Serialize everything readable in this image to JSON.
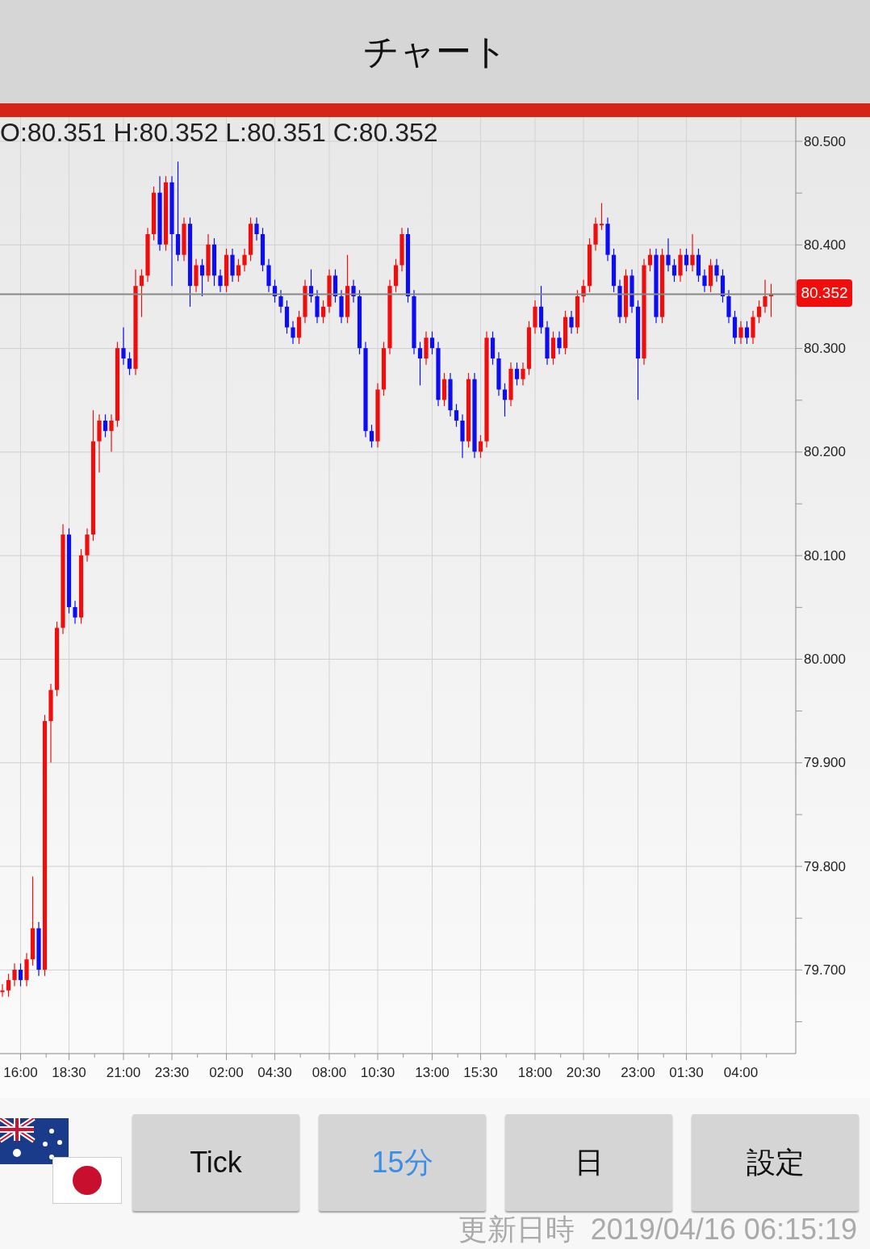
{
  "header": {
    "title": "チャート"
  },
  "chart": {
    "ohlc_readout": "O:80.351 H:80.352 L:80.351 C:80.352",
    "current_price": "80.352",
    "chart_data": {
      "type": "candlestick",
      "categories": [
        null,
        null,
        null,
        "16:00",
        null,
        null,
        null,
        null,
        null,
        null,
        null,
        "18:30",
        null,
        null,
        null,
        null,
        null,
        null,
        null,
        null,
        "21:00",
        null,
        null,
        null,
        null,
        null,
        null,
        null,
        "23:30",
        null,
        null,
        null,
        null,
        null,
        null,
        null,
        null,
        "02:00",
        null,
        null,
        null,
        null,
        null,
        null,
        null,
        "04:30",
        null,
        null,
        null,
        null,
        null,
        null,
        null,
        null,
        "08:00",
        null,
        null,
        null,
        null,
        null,
        null,
        null,
        "10:30",
        null,
        null,
        null,
        null,
        null,
        null,
        null,
        null,
        "13:00",
        null,
        null,
        null,
        null,
        null,
        null,
        null,
        "15:30",
        null,
        null,
        null,
        null,
        null,
        null,
        null,
        null,
        "18:00",
        null,
        null,
        null,
        null,
        null,
        null,
        null,
        "20:30",
        null,
        null,
        null,
        null,
        null,
        null,
        null,
        null,
        "23:00",
        null,
        null,
        null,
        null,
        null,
        null,
        null,
        "01:30",
        null,
        null,
        null,
        null,
        null,
        null,
        null,
        null,
        "04:00",
        null,
        null,
        null,
        null,
        null
      ],
      "ylim": [
        79.619,
        80.523
      ],
      "ohlc": [
        [
          79.68,
          79.686,
          79.674,
          79.68
        ],
        [
          79.68,
          79.696,
          79.674,
          79.69
        ],
        [
          79.69,
          79.706,
          79.684,
          79.7
        ],
        [
          79.7,
          79.706,
          79.684,
          79.69
        ],
        [
          79.69,
          79.716,
          79.684,
          79.71
        ],
        [
          79.71,
          79.79,
          79.704,
          79.74
        ],
        [
          79.74,
          79.746,
          79.694,
          79.7
        ],
        [
          79.7,
          79.946,
          79.694,
          79.94
        ],
        [
          79.94,
          79.976,
          79.9,
          79.97
        ],
        [
          79.97,
          80.036,
          79.964,
          80.03
        ],
        [
          80.03,
          80.13,
          80.024,
          80.12
        ],
        [
          80.12,
          80.126,
          80.044,
          80.05
        ],
        [
          80.05,
          80.056,
          80.034,
          80.04
        ],
        [
          80.04,
          80.106,
          80.034,
          80.1
        ],
        [
          80.1,
          80.126,
          80.094,
          80.12
        ],
        [
          80.12,
          80.24,
          80.114,
          80.21
        ],
        [
          80.21,
          80.236,
          80.18,
          80.23
        ],
        [
          80.23,
          80.236,
          80.214,
          80.22
        ],
        [
          80.22,
          80.236,
          80.2,
          80.23
        ],
        [
          80.23,
          80.306,
          80.224,
          80.3
        ],
        [
          80.3,
          80.32,
          80.284,
          80.29
        ],
        [
          80.29,
          80.296,
          80.274,
          80.28
        ],
        [
          80.28,
          80.376,
          80.274,
          80.36
        ],
        [
          80.36,
          80.376,
          80.33,
          80.37
        ],
        [
          80.37,
          80.416,
          80.364,
          80.41
        ],
        [
          80.41,
          80.456,
          80.404,
          80.45
        ],
        [
          80.45,
          80.466,
          80.394,
          80.4
        ],
        [
          80.4,
          80.466,
          80.394,
          80.46
        ],
        [
          80.46,
          80.466,
          80.36,
          80.41
        ],
        [
          80.41,
          80.48,
          80.384,
          80.39
        ],
        [
          80.39,
          80.426,
          80.384,
          80.42
        ],
        [
          80.42,
          80.426,
          80.34,
          80.36
        ],
        [
          80.36,
          80.386,
          80.354,
          80.38
        ],
        [
          80.38,
          80.386,
          80.35,
          80.37
        ],
        [
          80.37,
          80.41,
          80.364,
          80.4
        ],
        [
          80.4,
          80.406,
          80.36,
          80.37
        ],
        [
          80.37,
          80.376,
          80.354,
          80.36
        ],
        [
          80.36,
          80.396,
          80.354,
          80.39
        ],
        [
          80.39,
          80.396,
          80.364,
          80.37
        ],
        [
          80.37,
          80.386,
          80.364,
          80.38
        ],
        [
          80.38,
          80.396,
          80.374,
          80.39
        ],
        [
          80.39,
          80.426,
          80.384,
          80.42
        ],
        [
          80.42,
          80.426,
          80.404,
          80.41
        ],
        [
          80.41,
          80.416,
          80.374,
          80.38
        ],
        [
          80.38,
          80.386,
          80.354,
          80.36
        ],
        [
          80.36,
          80.366,
          80.344,
          80.35
        ],
        [
          80.35,
          80.356,
          80.334,
          80.34
        ],
        [
          80.34,
          80.346,
          80.314,
          80.32
        ],
        [
          80.32,
          80.326,
          80.304,
          80.31
        ],
        [
          80.31,
          80.336,
          80.304,
          80.33
        ],
        [
          80.33,
          80.366,
          80.324,
          80.36
        ],
        [
          80.36,
          80.376,
          80.344,
          80.35
        ],
        [
          80.35,
          80.356,
          80.324,
          80.33
        ],
        [
          80.33,
          80.346,
          80.324,
          80.34
        ],
        [
          80.34,
          80.376,
          80.334,
          80.37
        ],
        [
          80.37,
          80.376,
          80.344,
          80.35
        ],
        [
          80.35,
          80.356,
          80.324,
          80.33
        ],
        [
          80.33,
          80.39,
          80.324,
          80.36
        ],
        [
          80.36,
          80.366,
          80.344,
          80.35
        ],
        [
          80.35,
          80.356,
          80.294,
          80.3
        ],
        [
          80.3,
          80.306,
          80.214,
          80.22
        ],
        [
          80.22,
          80.226,
          80.204,
          80.21
        ],
        [
          80.21,
          80.266,
          80.204,
          80.26
        ],
        [
          80.26,
          80.306,
          80.254,
          80.3
        ],
        [
          80.3,
          80.366,
          80.294,
          80.36
        ],
        [
          80.36,
          80.386,
          80.354,
          80.38
        ],
        [
          80.38,
          80.416,
          80.374,
          80.41
        ],
        [
          80.41,
          80.416,
          80.344,
          80.35
        ],
        [
          80.35,
          80.356,
          80.294,
          80.3
        ],
        [
          80.3,
          80.306,
          80.264,
          80.29
        ],
        [
          80.29,
          80.316,
          80.284,
          80.31
        ],
        [
          80.31,
          80.316,
          80.294,
          80.3
        ],
        [
          80.3,
          80.306,
          80.244,
          80.25
        ],
        [
          80.25,
          80.276,
          80.244,
          80.27
        ],
        [
          80.27,
          80.276,
          80.234,
          80.24
        ],
        [
          80.24,
          80.246,
          80.224,
          80.23
        ],
        [
          80.23,
          80.236,
          80.194,
          80.21
        ],
        [
          80.21,
          80.276,
          80.204,
          80.27
        ],
        [
          80.27,
          80.276,
          80.194,
          80.2
        ],
        [
          80.2,
          80.216,
          80.194,
          80.21
        ],
        [
          80.21,
          80.316,
          80.204,
          80.31
        ],
        [
          80.31,
          80.316,
          80.284,
          80.29
        ],
        [
          80.29,
          80.296,
          80.254,
          80.26
        ],
        [
          80.26,
          80.266,
          80.234,
          80.25
        ],
        [
          80.25,
          80.286,
          80.244,
          80.28
        ],
        [
          80.28,
          80.286,
          80.264,
          80.27
        ],
        [
          80.27,
          80.286,
          80.264,
          80.28
        ],
        [
          80.28,
          80.326,
          80.274,
          80.32
        ],
        [
          80.32,
          80.346,
          80.314,
          80.34
        ],
        [
          80.34,
          80.36,
          80.314,
          80.32
        ],
        [
          80.32,
          80.326,
          80.284,
          80.29
        ],
        [
          80.29,
          80.316,
          80.284,
          80.31
        ],
        [
          80.31,
          80.316,
          80.294,
          80.3
        ],
        [
          80.3,
          80.336,
          80.294,
          80.33
        ],
        [
          80.33,
          80.336,
          80.314,
          80.32
        ],
        [
          80.32,
          80.356,
          80.314,
          80.35
        ],
        [
          80.35,
          80.366,
          80.344,
          80.36
        ],
        [
          80.36,
          80.406,
          80.354,
          80.4
        ],
        [
          80.4,
          80.426,
          80.394,
          80.42
        ],
        [
          80.42,
          80.44,
          80.414,
          80.42
        ],
        [
          80.42,
          80.426,
          80.384,
          80.39
        ],
        [
          80.39,
          80.396,
          80.354,
          80.36
        ],
        [
          80.36,
          80.366,
          80.324,
          80.33
        ],
        [
          80.33,
          80.376,
          80.324,
          80.37
        ],
        [
          80.37,
          80.376,
          80.334,
          80.34
        ],
        [
          80.34,
          80.346,
          80.25,
          80.29
        ],
        [
          80.29,
          80.386,
          80.284,
          80.38
        ],
        [
          80.38,
          80.396,
          80.374,
          80.39
        ],
        [
          80.39,
          80.396,
          80.324,
          80.33
        ],
        [
          80.33,
          80.396,
          80.324,
          80.39
        ],
        [
          80.39,
          80.406,
          80.374,
          80.38
        ],
        [
          80.38,
          80.386,
          80.364,
          80.37
        ],
        [
          80.37,
          80.396,
          80.364,
          80.39
        ],
        [
          80.39,
          80.396,
          80.374,
          80.38
        ],
        [
          80.38,
          80.41,
          80.374,
          80.39
        ],
        [
          80.39,
          80.396,
          80.364,
          80.37
        ],
        [
          80.37,
          80.376,
          80.354,
          80.36
        ],
        [
          80.36,
          80.386,
          80.354,
          80.38
        ],
        [
          80.38,
          80.386,
          80.364,
          80.37
        ],
        [
          80.37,
          80.376,
          80.344,
          80.35
        ],
        [
          80.35,
          80.356,
          80.324,
          80.33
        ],
        [
          80.33,
          80.336,
          80.304,
          80.31
        ],
        [
          80.31,
          80.326,
          80.304,
          80.32
        ],
        [
          80.32,
          80.326,
          80.304,
          80.31
        ],
        [
          80.31,
          80.336,
          80.304,
          80.33
        ],
        [
          80.33,
          80.346,
          80.324,
          80.34
        ],
        [
          80.34,
          80.366,
          80.334,
          80.35
        ],
        [
          80.35,
          80.362,
          80.33,
          80.352
        ]
      ],
      "yticks": [
        {
          "value": 80.5,
          "label": "80.500"
        },
        {
          "value": 80.4,
          "label": "80.400"
        },
        {
          "value": 80.3,
          "label": "80.300"
        },
        {
          "value": 80.2,
          "label": "80.200"
        },
        {
          "value": 80.1,
          "label": "80.100"
        },
        {
          "value": 80.0,
          "label": "80.000"
        },
        {
          "value": 79.9,
          "label": "79.900"
        },
        {
          "value": 79.8,
          "label": "79.800"
        },
        {
          "value": 79.7,
          "label": "79.700"
        }
      ],
      "grid": true,
      "ref_lines": [
        {
          "axis": "y",
          "value": 80.352
        }
      ]
    }
  },
  "buttons": [
    {
      "label": "Tick",
      "selected": false
    },
    {
      "label": "15分",
      "selected": true
    },
    {
      "label": "日",
      "selected": false
    },
    {
      "label": "設定",
      "selected": false
    }
  ],
  "updated": "更新日時  2019/04/16 06:15:19"
}
